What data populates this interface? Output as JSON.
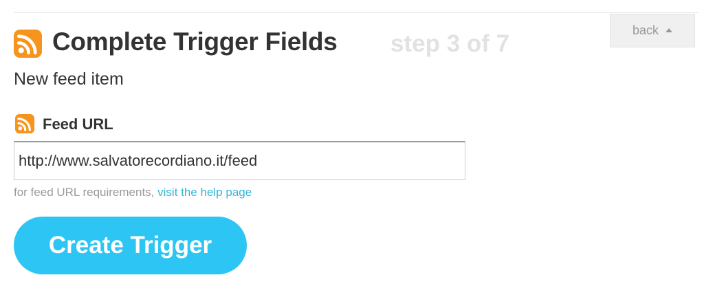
{
  "header": {
    "title": "Complete Trigger Fields",
    "step": "step 3 of 7",
    "back_label": "back",
    "icon": "rss-icon",
    "icon_color": "#f7941e"
  },
  "trigger": {
    "name": "New feed item"
  },
  "field": {
    "label": "Feed URL",
    "icon": "rss-icon",
    "value": "http://www.salvatorecordiano.it/feed",
    "help_prefix": "for feed URL requirements, ",
    "help_link": "visit the help page"
  },
  "actions": {
    "create_label": "Create Trigger",
    "create_color": "#2dc6f4"
  },
  "colors": {
    "link": "#33b5d8",
    "muted": "#999999",
    "text": "#333333"
  }
}
